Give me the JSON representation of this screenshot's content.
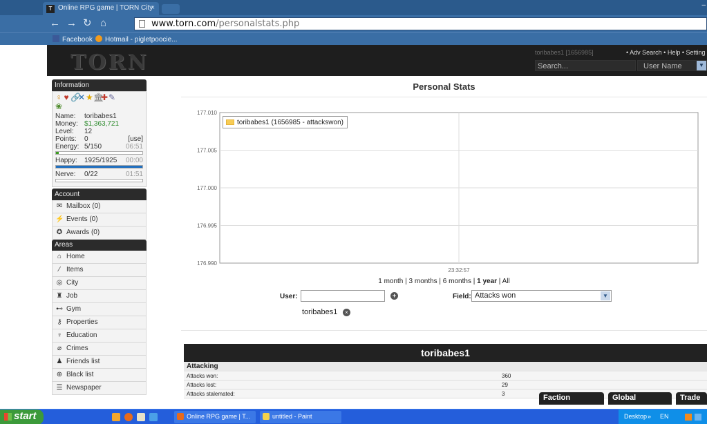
{
  "browser": {
    "tab_title": "Online RPG game | TORN City",
    "tab_close": "×",
    "url_host": "www.torn.com",
    "url_path": "/personalstats.php",
    "bookmarks": [
      "Facebook",
      "Hotmail - pigletpoocie..."
    ]
  },
  "header": {
    "logo": "TORN",
    "user_id": "toribabes1 [1656985]",
    "links": "• Adv Search  • Help  • Setting",
    "search_placeholder": "Search...",
    "search_scope": "User Name"
  },
  "sidebar": {
    "information_title": "Information",
    "status_icons": [
      "♀",
      "♥",
      "🔗",
      "✕",
      "★",
      "🏛",
      "✚",
      "✎",
      "❀"
    ],
    "name_label": "Name:",
    "name": "toribabes1",
    "money_label": "Money:",
    "money": "$1,363,721",
    "level_label": "Level:",
    "level": "12",
    "points_label": "Points:",
    "points": "0",
    "points_use": "[use]",
    "energy_label": "Energy:",
    "energy": "5/150",
    "energy_timer": "06:51",
    "energy_fraction": 0.033,
    "happy_label": "Happy:",
    "happy": "1925/1925",
    "happy_timer": "00:00",
    "happy_fraction": 1.0,
    "nerve_label": "Nerve:",
    "nerve": "0/22",
    "nerve_timer": "01:51",
    "nerve_fraction": 0.0,
    "account_title": "Account",
    "account_items": [
      {
        "icon": "mail-icon",
        "label": "Mailbox (0)"
      },
      {
        "icon": "events-icon",
        "label": "Events (0)"
      },
      {
        "icon": "awards-icon",
        "label": "Awards (0)"
      }
    ],
    "areas_title": "Areas",
    "area_items": [
      {
        "icon": "home-icon",
        "label": "Home"
      },
      {
        "icon": "items-icon",
        "label": "Items"
      },
      {
        "icon": "city-icon",
        "label": "City"
      },
      {
        "icon": "job-icon",
        "label": "Job"
      },
      {
        "icon": "gym-icon",
        "label": "Gym"
      },
      {
        "icon": "properties-icon",
        "label": "Properties"
      },
      {
        "icon": "education-icon",
        "label": "Education"
      },
      {
        "icon": "crimes-icon",
        "label": "Crimes"
      },
      {
        "icon": "friends-icon",
        "label": "Friends list"
      },
      {
        "icon": "blacklist-icon",
        "label": "Black list"
      },
      {
        "icon": "newspaper-icon",
        "label": "Newspaper"
      }
    ]
  },
  "main": {
    "title": "Personal Stats",
    "range_links": "1 month | 3 months | 6 months | ",
    "range_active": "1 year",
    "range_all": " | All",
    "user_label": "User:",
    "user_input_value": "",
    "field_label": "Field:",
    "field_value": "Attacks won",
    "selected_user": "toribabes1"
  },
  "chart_data": {
    "type": "line",
    "legend": "toribabes1 (1656985 - attackswon)",
    "series": [
      {
        "name": "toribabes1 (1656985 - attackswon)",
        "x": [],
        "values": []
      }
    ],
    "yticks": [
      "177.010",
      "177.005",
      "177.000",
      "176.995",
      "176.990"
    ],
    "ylim": [
      176.99,
      177.01
    ],
    "xtick": "23:32:57",
    "grid": true
  },
  "profile": {
    "name": "toribabes1",
    "section": "Attacking",
    "rows": [
      {
        "label": "Attacks won:",
        "value": "360"
      },
      {
        "label": "Attacks lost:",
        "value": "29"
      },
      {
        "label": "Attacks stalemated:",
        "value": "3"
      }
    ],
    "tabs": [
      "Faction",
      "Global",
      "Trade"
    ]
  },
  "taskbar": {
    "start": "start",
    "tasks": [
      "Online RPG game | T...",
      "untitled - Paint"
    ],
    "tray_desktop": "Desktop",
    "tray_lang": "EN"
  }
}
